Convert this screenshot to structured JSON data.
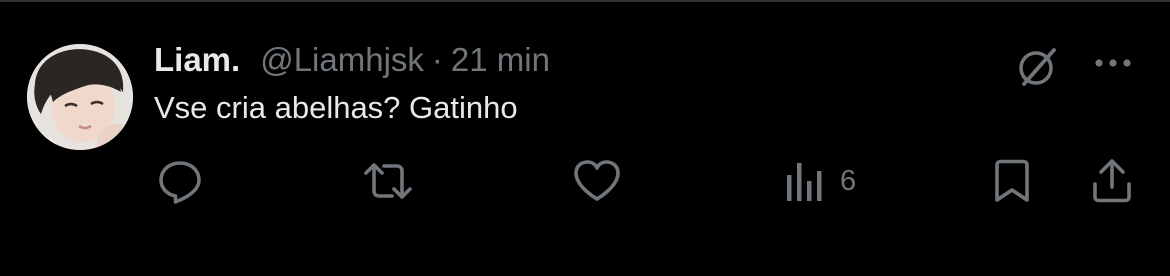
{
  "tweet": {
    "display_name": "Liam.",
    "handle": "@Liamhjsk",
    "separator": "·",
    "time": "21 min",
    "text": "Vse cria abelhas? Gatinho"
  },
  "actions": {
    "reply": {
      "icon": "reply-bubble-icon"
    },
    "retweet": {
      "icon": "retweet-arrows-icon"
    },
    "like": {
      "icon": "heart-icon"
    },
    "views": {
      "icon": "views-bar-chart-icon",
      "count": "6"
    },
    "bookmark": {
      "icon": "bookmark-icon"
    },
    "share": {
      "icon": "share-upload-icon"
    }
  },
  "top_right": {
    "grok": {
      "icon": "grok-slash-circle-icon"
    },
    "more": {
      "icon": "more-dots-icon"
    }
  },
  "colors": {
    "background": "#000000",
    "primary_text": "#e7e9ea",
    "secondary_text": "#71767b",
    "divider": "#2f3336"
  }
}
